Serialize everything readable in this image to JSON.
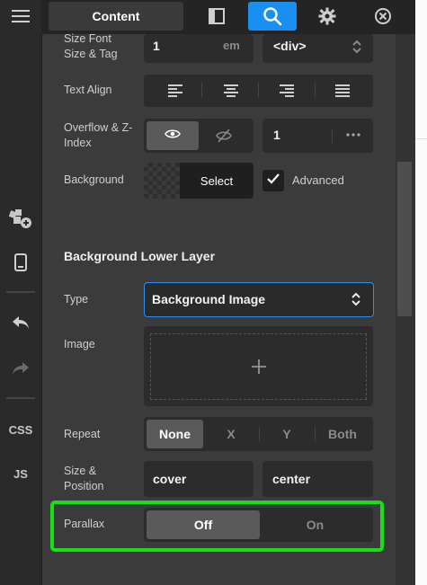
{
  "topbar": {
    "content_tab": "Content"
  },
  "rail": {
    "css_label": "CSS",
    "js_label": "JS"
  },
  "fields": {
    "size_tag_label": "Size Font Size & Tag",
    "size_value": "1",
    "size_unit": "em",
    "tag_value": "<div>",
    "text_align_label": "Text Align",
    "overflow_label": "Overflow & Z-Index",
    "zindex_value": "1",
    "background_label": "Background",
    "background_select": "Select",
    "advanced_label": "Advanced",
    "advanced_checked": true
  },
  "lower_layer": {
    "title": "Background Lower Layer",
    "type_label": "Type",
    "type_value": "Background Image",
    "image_label": "Image",
    "repeat_label": "Repeat",
    "repeat_options": [
      "None",
      "X",
      "Y",
      "Both"
    ],
    "repeat_selected": "None",
    "size_position_label": "Size & Position",
    "size_value": "cover",
    "position_value": "center",
    "parallax_label": "Parallax",
    "parallax_off": "Off",
    "parallax_on": "On",
    "parallax_selected": "Off"
  },
  "colors": {
    "accent": "#1a8ff2",
    "highlight": "#16e016"
  }
}
